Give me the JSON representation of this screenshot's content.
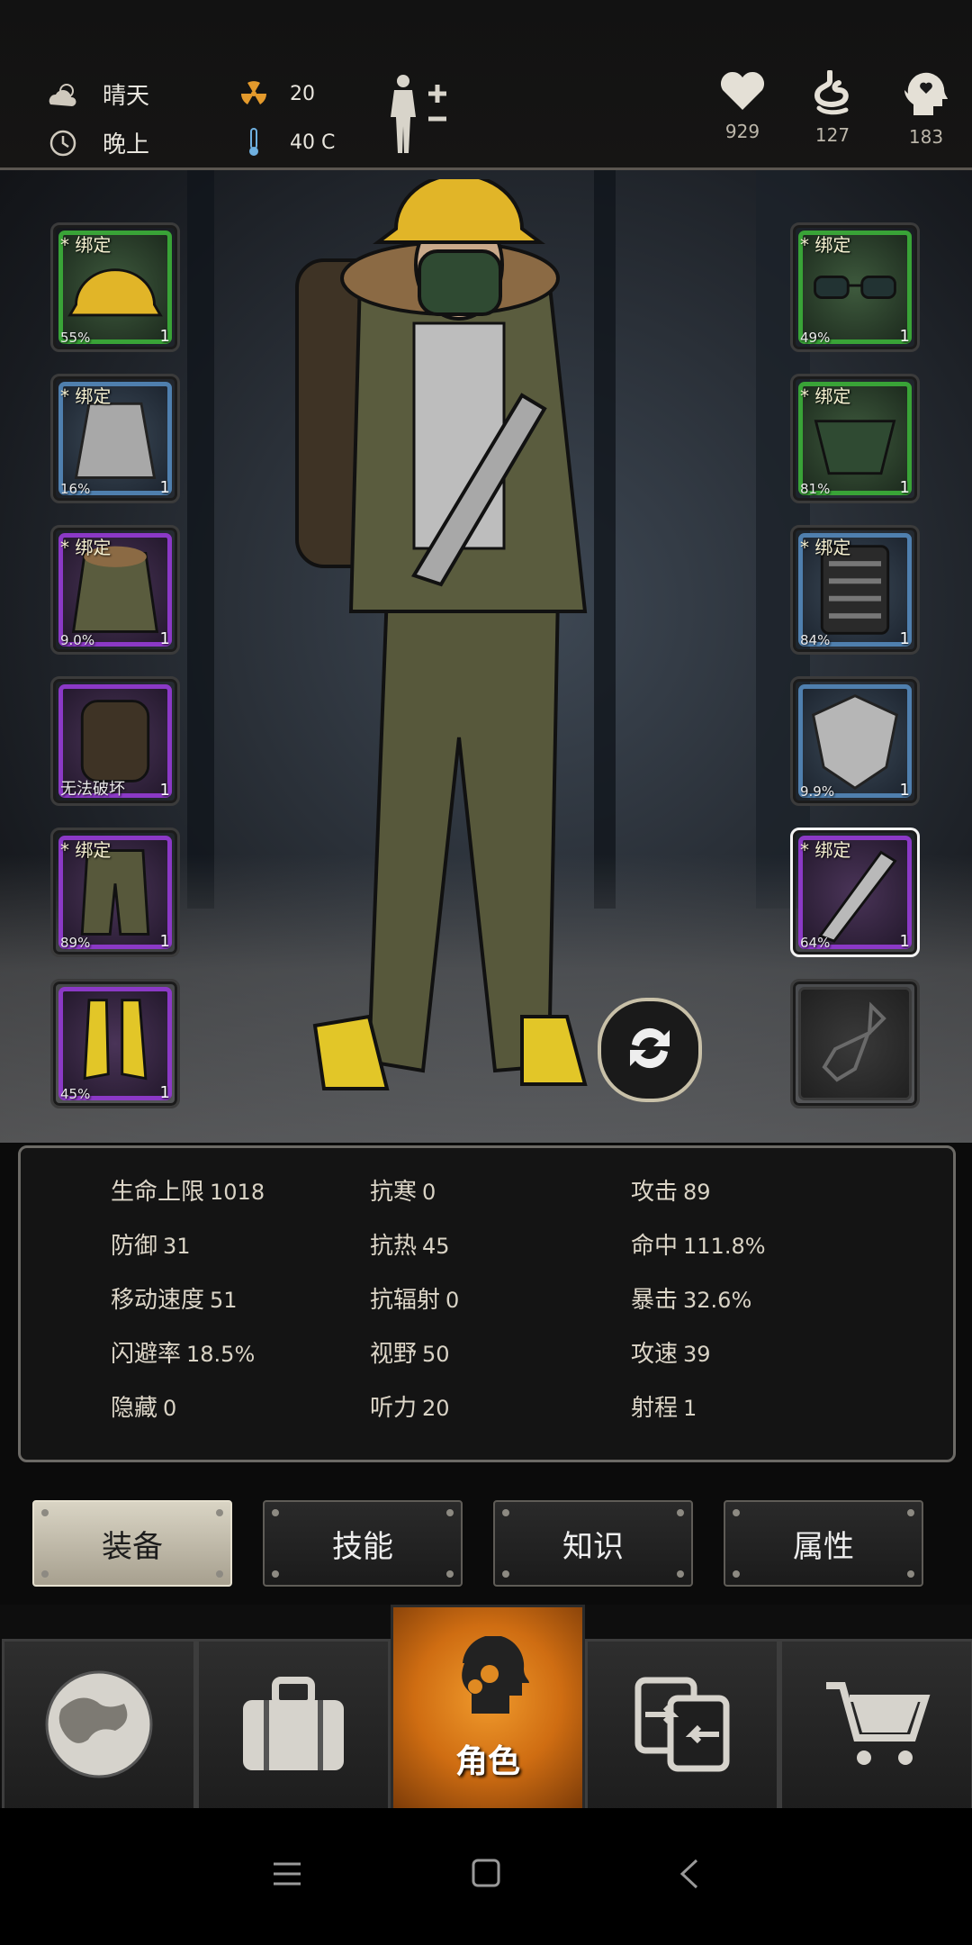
{
  "status": {
    "weather": "晴天",
    "time_of_day": "晚上",
    "radiation": "20",
    "temperature": "40 C"
  },
  "vitals": {
    "health": "929",
    "hunger": "127",
    "mind": "183"
  },
  "left_slots": [
    {
      "tag": "* 绑定",
      "pct": "55%",
      "qty": "1",
      "rarity": "green",
      "item_icon": "hard-hat-icon"
    },
    {
      "tag": "* 绑定",
      "pct": "16%",
      "qty": "1",
      "rarity": "blue",
      "item_icon": "shirt-icon"
    },
    {
      "tag": "* 绑定",
      "pct": "9.0%",
      "qty": "1",
      "rarity": "purple",
      "item_icon": "jacket-icon"
    },
    {
      "tag": "",
      "pct": "无法破坏",
      "qty": "1",
      "rarity": "purple",
      "item_icon": "backpack-icon"
    },
    {
      "tag": "* 绑定",
      "pct": "89%",
      "qty": "1",
      "rarity": "purple",
      "item_icon": "pants-icon"
    },
    {
      "tag": "",
      "pct": "45%",
      "qty": "1",
      "rarity": "purple",
      "item_icon": "boots-icon"
    }
  ],
  "right_slots": [
    {
      "tag": "* 绑定",
      "pct": "49%",
      "qty": "1",
      "rarity": "green",
      "item_icon": "glasses-icon"
    },
    {
      "tag": "* 绑定",
      "pct": "81%",
      "qty": "1",
      "rarity": "green",
      "item_icon": "gas-mask-icon"
    },
    {
      "tag": "* 绑定",
      "pct": "84%",
      "qty": "1",
      "rarity": "blue",
      "item_icon": "vest-icon"
    },
    {
      "tag": "",
      "pct": "9.9%",
      "qty": "1",
      "rarity": "blue",
      "item_icon": "shield-icon"
    },
    {
      "tag": "* 绑定",
      "pct": "64%",
      "qty": "1",
      "rarity": "purple",
      "item_icon": "machete-icon"
    },
    {
      "tag": "",
      "pct": "",
      "qty": "",
      "rarity": "empty",
      "item_icon": "bottle-icon"
    }
  ],
  "stats": {
    "col1": [
      {
        "label": "生命上限",
        "value": "1018"
      },
      {
        "label": "防御",
        "value": "31"
      },
      {
        "label": "移动速度",
        "value": "51"
      },
      {
        "label": "闪避率",
        "value": "18.5%"
      },
      {
        "label": "隐藏",
        "value": "0"
      }
    ],
    "col2": [
      {
        "label": "抗寒",
        "value": "0"
      },
      {
        "label": "抗热",
        "value": "45"
      },
      {
        "label": "抗辐射",
        "value": "0"
      },
      {
        "label": "视野",
        "value": "50"
      },
      {
        "label": "听力",
        "value": "20"
      }
    ],
    "col3": [
      {
        "label": "攻击",
        "value": "89"
      },
      {
        "label": "命中",
        "value": "111.8%"
      },
      {
        "label": "暴击",
        "value": "32.6%"
      },
      {
        "label": "攻速",
        "value": "39"
      },
      {
        "label": "射程",
        "value": "1"
      }
    ]
  },
  "tabs": [
    "装备",
    "技能",
    "知识",
    "属性"
  ],
  "bottom_nav": {
    "active_label": "角色",
    "items": [
      "globe-icon",
      "suitcase-icon",
      "character-head-icon",
      "trade-icon",
      "cart-icon"
    ]
  },
  "colors": {
    "green": "#39a337",
    "blue": "#4f7fae",
    "purple": "#8b39c6",
    "accent_orange": "#e08a22"
  }
}
